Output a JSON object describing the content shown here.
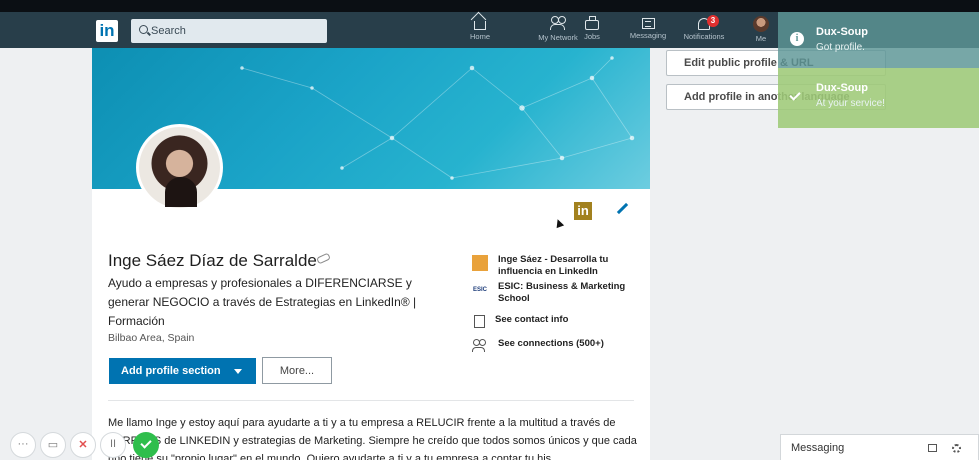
{
  "navbar": {
    "logo": "in",
    "search_placeholder": "Search",
    "items": [
      {
        "label": "Home"
      },
      {
        "label": "My Network"
      },
      {
        "label": "Jobs"
      },
      {
        "label": "Messaging"
      },
      {
        "label": "Notifications",
        "badge": "3"
      },
      {
        "label": "Me"
      }
    ]
  },
  "profile": {
    "name": "Inge Sáez Díaz de Sarralde",
    "headline": "Ayudo a empresas y profesionales a DIFERENCIARSE y generar NEGOCIO a través de Estrategias en LinkedIn® | Formación",
    "location": "Bilbao Area, Spain",
    "add_section_label": "Add profile section",
    "more_label": "More...",
    "about": "Me llamo Inge y estoy aquí para ayudarte a ti y a tu empresa a RELUCIR frente a la multitud a través de PERFILES de LINKEDIN y estrategias de Marketing.      Siempre he creído que todos somos únicos y que cada uno tiene su \"propio lugar\" en el mundo. Quiero ayudarte a ti y a tu empresa a contar tu his...",
    "sidebar": [
      {
        "text": "Inge Sáez - Desarrolla tu influencia en LinkedIn",
        "icon": "company-logo-icon"
      },
      {
        "text": "ESIC: Business & Marketing School",
        "icon": "esic-logo-icon",
        "icon_text": "ESIC"
      },
      {
        "text": "See contact info",
        "icon": "contact-card-icon"
      },
      {
        "text": "See connections (500+)",
        "icon": "connections-icon"
      }
    ]
  },
  "right": {
    "edit_url_label": "Edit public profile & URL",
    "add_language_label": "Add profile in another language"
  },
  "duxsoup": [
    {
      "title": "Dux-Soup",
      "message": "Got profile."
    },
    {
      "title": "Dux-Soup",
      "message": "At your service!"
    }
  ],
  "messaging": {
    "label": "Messaging"
  },
  "call_controls": {
    "more": "···",
    "pause": "II",
    "close": "✕"
  },
  "colors": {
    "navbar": "#283e4a",
    "primary": "#0073b1",
    "dux_info": "#5d9696",
    "dux_ok": "#9eca78"
  }
}
